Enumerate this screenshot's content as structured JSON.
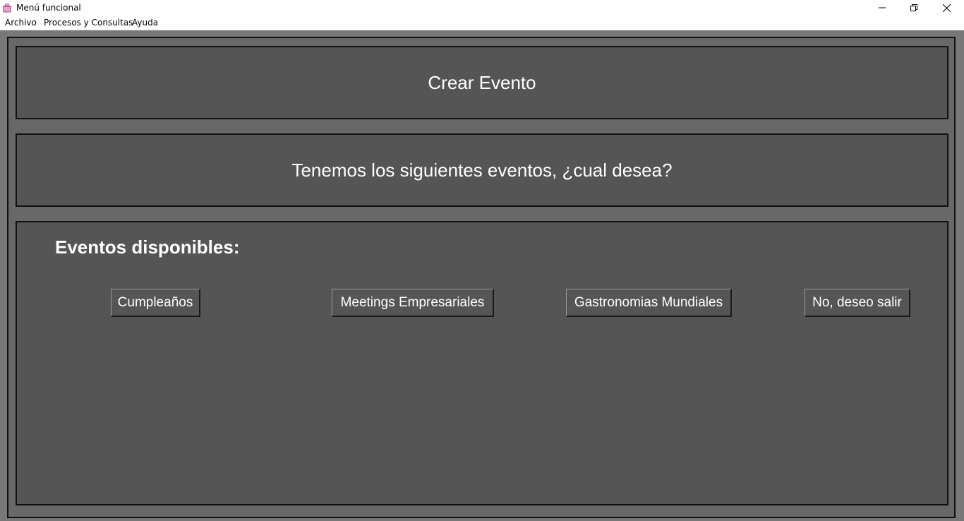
{
  "window": {
    "title": "Menú funcional",
    "icon": "app-icon",
    "controls": [
      "minimize-icon",
      "maximize-icon",
      "close-icon"
    ]
  },
  "menubar": {
    "items": [
      "Archivo",
      "Procesos y Consultas",
      "Ayuda"
    ]
  },
  "main": {
    "title": "Crear Evento",
    "question": "Tenemos los siguientes eventos, ¿cual desea?",
    "events_heading": "Eventos disponibles:",
    "buttons": [
      "Cumpleaños",
      "Meetings Empresariales",
      "Gastronomias Mundiales",
      "No, deseo salir"
    ]
  },
  "colors": {
    "outer_background": "#787878",
    "panel_background": "#555555",
    "text": "#ffffff"
  }
}
